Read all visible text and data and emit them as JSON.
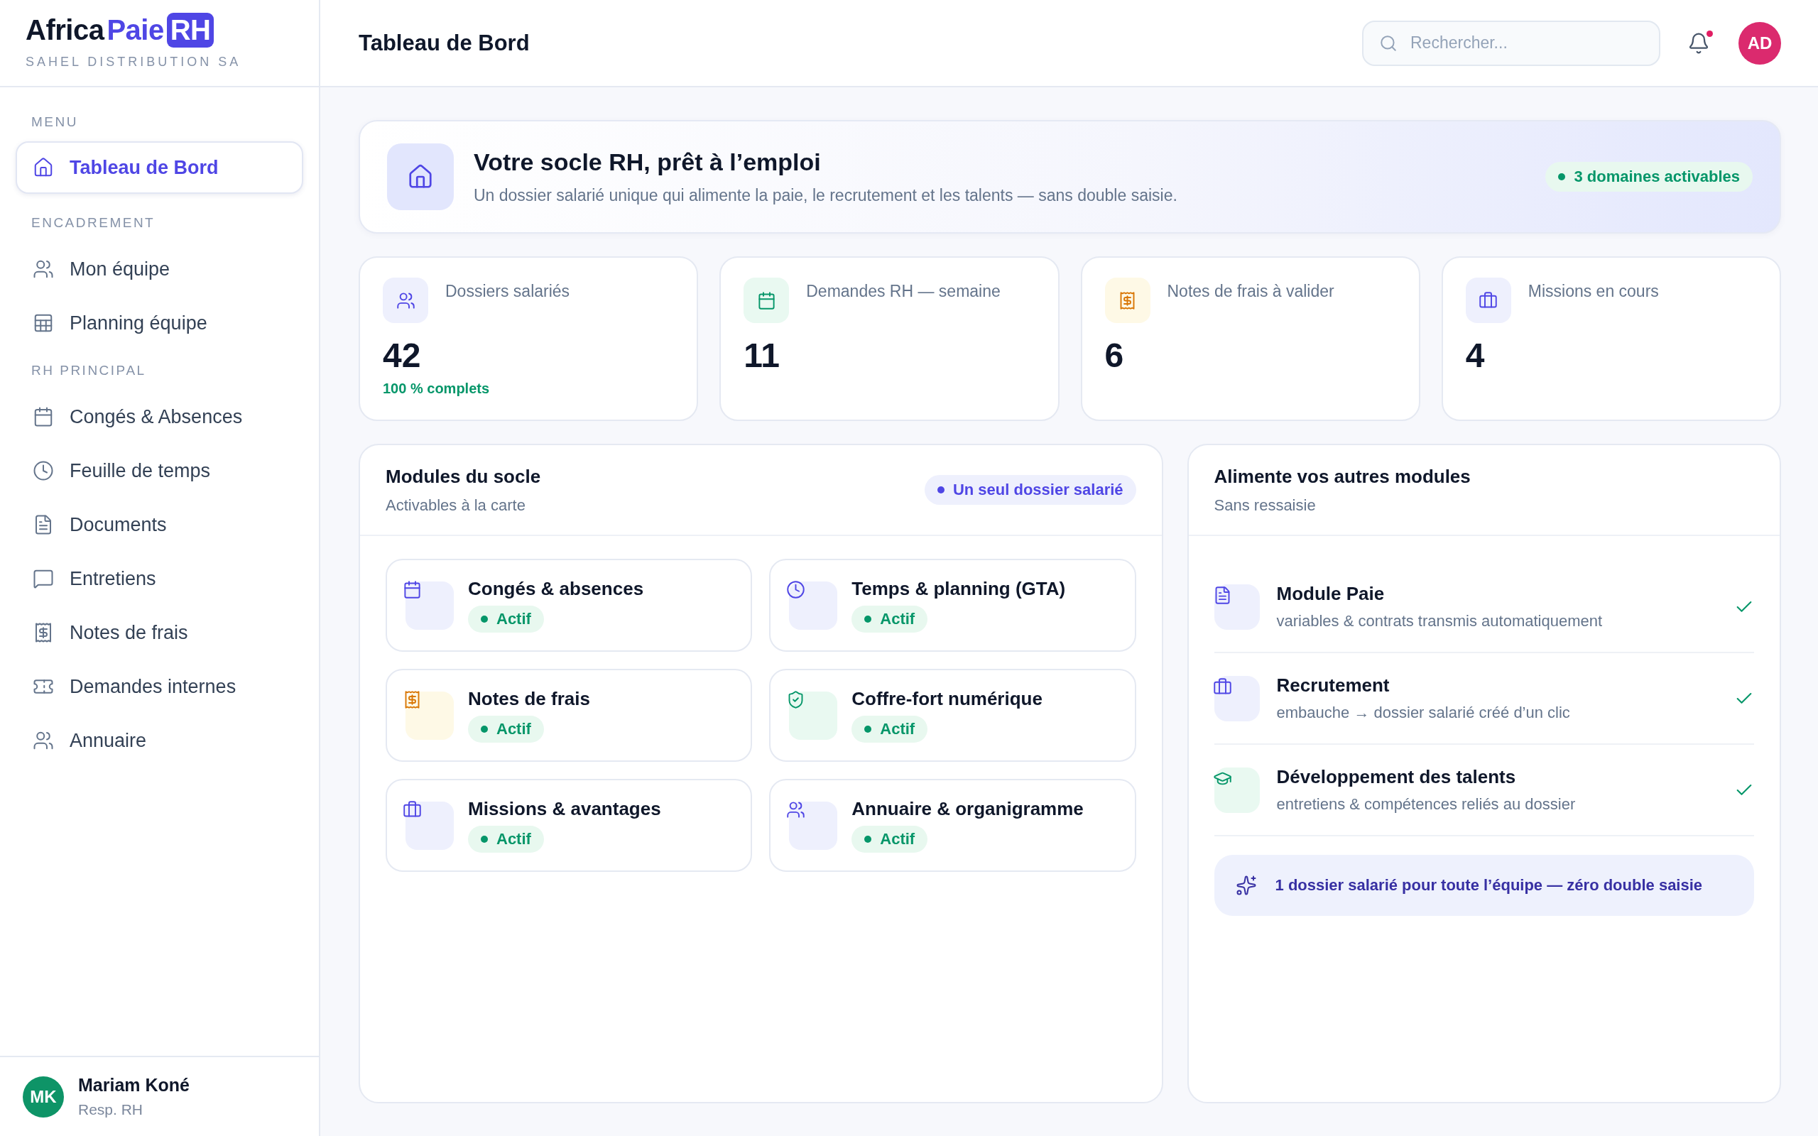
{
  "sidebar": {
    "logo": {
      "dark_part": "Africa",
      "accent_part": "Paie",
      "badge": "RH"
    },
    "company": "SAHEL DISTRIBUTION SA",
    "groups": [
      {
        "title": "MENU",
        "items": [
          {
            "label": "Tableau de Bord",
            "selected": true
          }
        ]
      },
      {
        "title": "ENCADREMENT",
        "items": [
          {
            "label": "Mon équipe",
            "selected": false
          },
          {
            "label": "Planning équipe",
            "selected": false
          }
        ]
      },
      {
        "title": "RH PRINCIPAL",
        "items": [
          {
            "label": "Congés & Absences",
            "selected": false
          },
          {
            "label": "Feuille de temps",
            "selected": false
          },
          {
            "label": "Documents",
            "selected": false
          },
          {
            "label": "Entretiens",
            "selected": false
          },
          {
            "label": "Notes de frais",
            "selected": false
          },
          {
            "label": "Demandes internes",
            "selected": false
          },
          {
            "label": "Annuaire",
            "selected": false
          }
        ]
      }
    ],
    "user": {
      "initials": "MK",
      "name": "Mariam Koné",
      "role": "Resp. RH"
    }
  },
  "header": {
    "title": "Tableau de Bord",
    "search": {
      "placeholder": "Rechercher..."
    },
    "notifications_unread": true,
    "avatar": "AD"
  },
  "hero": {
    "title": "Votre socle RH, prêt à l’emploi",
    "subtitle": "Un dossier salarié unique qui alimente la paie, le recrutement et les talents — sans double saisie.",
    "badge": "3 domaines activables"
  },
  "stats": [
    {
      "label": "Dossiers salariés",
      "value": "42",
      "note": "100 % complets",
      "color": "#eef0fd"
    },
    {
      "label": "Demandes RH — semaine",
      "value": "11",
      "color": "#e9f9f1"
    },
    {
      "label": "Notes de frais à valider",
      "value": "6",
      "color": "#fef9e6"
    },
    {
      "label": "Missions en cours",
      "value": "4",
      "color": "#eef0fd"
    }
  ],
  "modules_panel": {
    "title": "Modules du socle",
    "subtitle": "Activables à la carte",
    "badge": "Un seul dossier salarié",
    "modules": [
      {
        "title": "Congés & absences",
        "status": "Actif",
        "color": "#eef0fd"
      },
      {
        "title": "Temps & planning (GTA)",
        "status": "Actif",
        "color": "#eef0fd"
      },
      {
        "title": "Notes de frais",
        "status": "Actif",
        "color": "#fef9e6"
      },
      {
        "title": "Coffre-fort numérique",
        "status": "Actif",
        "color": "#e9f9f1"
      },
      {
        "title": "Missions & avantages",
        "status": "Actif",
        "color": "#eef0fd"
      },
      {
        "title": "Annuaire & organigramme",
        "status": "Actif",
        "color": "#eef0fd"
      }
    ]
  },
  "feeds_panel": {
    "title": "Alimente vos autres modules",
    "subtitle": "Sans ressaisie",
    "feeds": [
      {
        "title": "Module Paie",
        "description": "variables & contrats transmis automatiquement",
        "checked": true,
        "color": "#eef0fd"
      },
      {
        "title": "Recrutement",
        "description": "embauche → dossier salarié créé d’un clic",
        "checked": true,
        "color": "#eef0fd"
      },
      {
        "title": "Développement des talents",
        "description": "entretiens & compétences reliés au dossier",
        "checked": true,
        "color": "#e9f9f1"
      }
    ],
    "callout": "1 dossier salarié pour toute l’équipe — zéro double saisie"
  }
}
